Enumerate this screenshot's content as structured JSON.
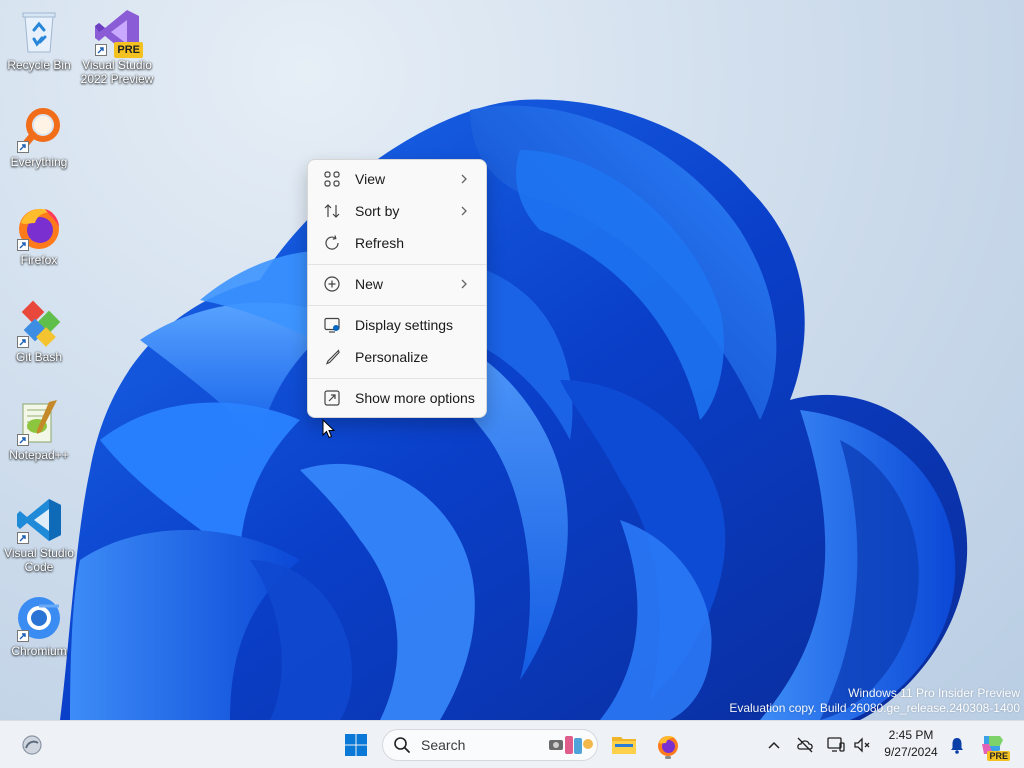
{
  "desktop": {
    "icons": [
      {
        "label": "Recycle Bin"
      },
      {
        "label": "Visual Studio 2022 Preview",
        "badge": "PRE"
      },
      {
        "label": "Everything"
      },
      {
        "label": "Firefox"
      },
      {
        "label": "Git Bash"
      },
      {
        "label": "Notepad++"
      },
      {
        "label": "Visual Studio Code"
      },
      {
        "label": "Chromium"
      }
    ]
  },
  "context_menu": {
    "items": [
      {
        "label": "View",
        "icon": "grid-icon",
        "submenu": true
      },
      {
        "label": "Sort by",
        "icon": "sort-icon",
        "submenu": true
      },
      {
        "label": "Refresh",
        "icon": "refresh-icon",
        "submenu": false
      },
      {
        "label": "New",
        "icon": "plus-circle-icon",
        "submenu": true
      },
      {
        "label": "Display settings",
        "icon": "display-icon",
        "submenu": false
      },
      {
        "label": "Personalize",
        "icon": "brush-icon",
        "submenu": false
      },
      {
        "label": "Show more options",
        "icon": "more-options-icon",
        "submenu": false
      }
    ]
  },
  "watermark": {
    "line1": "Windows 11 Pro Insider Preview",
    "line2": "Evaluation copy. Build 26080.ge_release.240308-1400"
  },
  "taskbar": {
    "search_placeholder": "Search",
    "clock": {
      "time": "2:45 PM",
      "date": "9/27/2024"
    },
    "copilot_badge": "PRE",
    "accent_color": "#0067c0"
  }
}
